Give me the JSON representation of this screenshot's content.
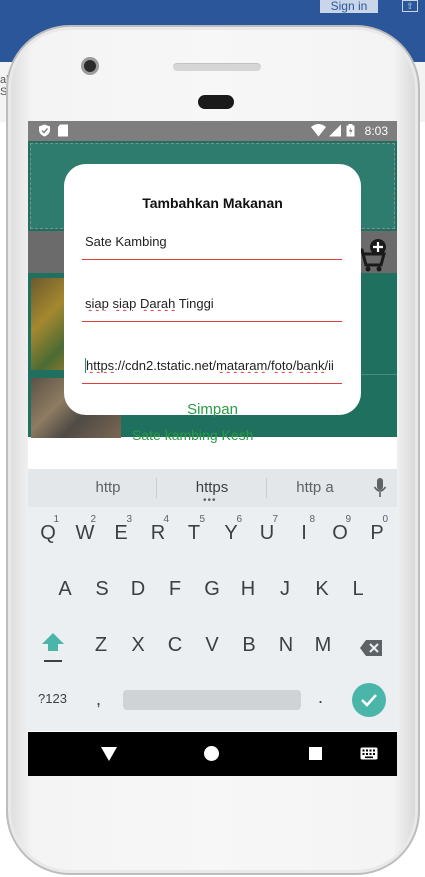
{
  "host": {
    "signin_label": "Sign in",
    "side_text": "al S"
  },
  "status": {
    "time": "8:03"
  },
  "background_app": {
    "list_text": "Sate kambing Kesh"
  },
  "dialog": {
    "title": "Tambahkan Makanan",
    "name_field": {
      "value": "Sate Kambing"
    },
    "desc_field": {
      "value_parts": [
        "siap",
        " ",
        "siap",
        " ",
        "Darah",
        " Tinggi"
      ]
    },
    "url_field": {
      "value_parts": [
        "https",
        "://cdn2.tstatic.net/",
        "mataram",
        "/",
        "foto",
        "/",
        "bank",
        "/ii"
      ]
    },
    "save_label": "Simpan"
  },
  "keyboard": {
    "suggestions": [
      "http",
      "https",
      "http a"
    ],
    "row1": [
      {
        "k": "Q",
        "h": "1"
      },
      {
        "k": "W",
        "h": "2"
      },
      {
        "k": "E",
        "h": "3"
      },
      {
        "k": "R",
        "h": "4"
      },
      {
        "k": "T",
        "h": "5"
      },
      {
        "k": "Y",
        "h": "6"
      },
      {
        "k": "U",
        "h": "7"
      },
      {
        "k": "I",
        "h": "8"
      },
      {
        "k": "O",
        "h": "9"
      },
      {
        "k": "P",
        "h": "0"
      }
    ],
    "row2": [
      "A",
      "S",
      "D",
      "F",
      "G",
      "H",
      "J",
      "K",
      "L"
    ],
    "row3": [
      "Z",
      "X",
      "C",
      "V",
      "B",
      "N",
      "M"
    ],
    "symbols_label": "?123",
    "comma_label": ",",
    "period_label": ".",
    "accent_color": "#4ab6a9"
  },
  "icons": {
    "status_left": [
      "shield-icon",
      "sd-card-icon"
    ],
    "status_right": [
      "wifi-icon",
      "signal-icon",
      "battery-icon"
    ],
    "cart": "add-to-cart-icon",
    "nav": [
      "back-icon",
      "home-icon",
      "recents-icon",
      "keyboard-icon"
    ]
  }
}
